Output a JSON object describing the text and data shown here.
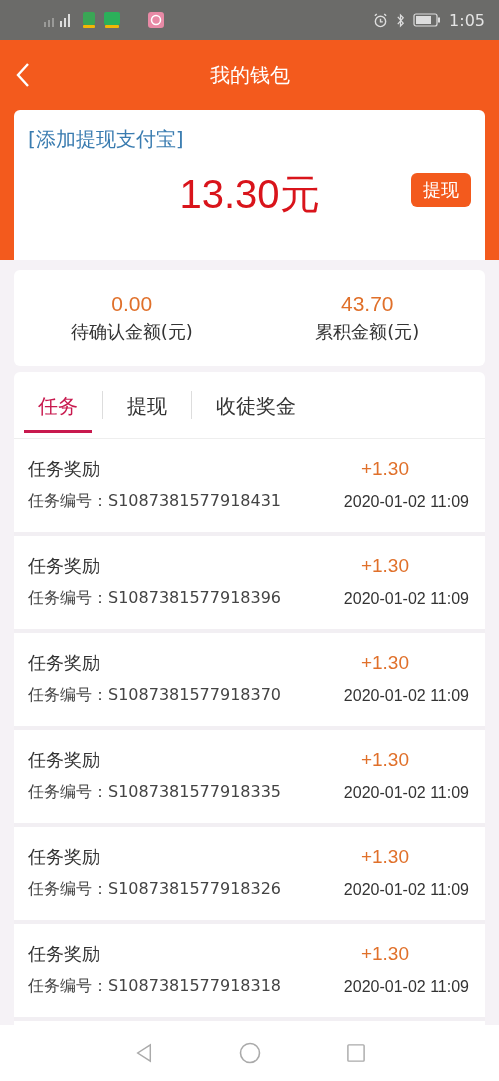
{
  "status_bar": {
    "time": "1:05"
  },
  "header": {
    "title": "我的钱包"
  },
  "wallet": {
    "link": "[添加提现支付宝]",
    "balance": "13.30元",
    "withdraw_button": "提现"
  },
  "stats": [
    {
      "value": "0.00",
      "label": "待确认金额(元)"
    },
    {
      "value": "43.70",
      "label": "累积金额(元)"
    }
  ],
  "tabs": [
    {
      "label": "任务",
      "selected": true
    },
    {
      "label": "提现",
      "selected": false
    },
    {
      "label": "收徒奖金",
      "selected": false
    }
  ],
  "records": [
    {
      "title": "任务奖励",
      "amount": "+1.30",
      "number": "任务编号：S1087381577918431",
      "time": "2020-01-02 11:09"
    },
    {
      "title": "任务奖励",
      "amount": "+1.30",
      "number": "任务编号：S1087381577918396",
      "time": "2020-01-02 11:09"
    },
    {
      "title": "任务奖励",
      "amount": "+1.30",
      "number": "任务编号：S1087381577918370",
      "time": "2020-01-02 11:09"
    },
    {
      "title": "任务奖励",
      "amount": "+1.30",
      "number": "任务编号：S1087381577918335",
      "time": "2020-01-02 11:09"
    },
    {
      "title": "任务奖励",
      "amount": "+1.30",
      "number": "任务编号：S1087381577918326",
      "time": "2020-01-02 11:09"
    },
    {
      "title": "任务奖励",
      "amount": "+1.30",
      "number": "任务编号：S1087381577918318",
      "time": "2020-01-02 11:09"
    }
  ]
}
